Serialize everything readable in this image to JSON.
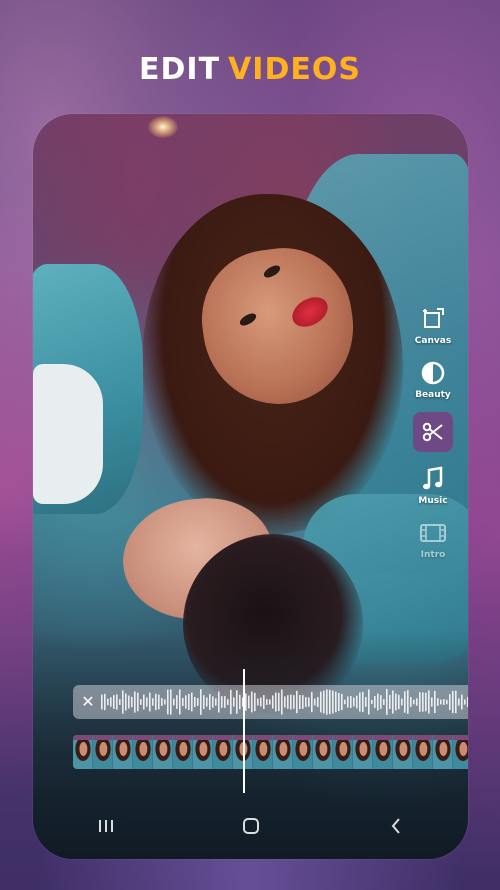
{
  "headline": {
    "word1": "EDIT",
    "word2": "VIDEOS"
  },
  "colors": {
    "accent": "#ffb21e",
    "tool_active_bg": "#6d4a86",
    "background": "#5b3f78"
  },
  "tools": [
    {
      "label": "Canvas",
      "icon": "canvas-icon"
    },
    {
      "label": "Beauty",
      "icon": "beauty-icon"
    },
    {
      "label": "",
      "icon": "scissors-icon",
      "active": true
    },
    {
      "label": "Music",
      "icon": "music-note-icon"
    },
    {
      "label": "Intro",
      "icon": "film-strip-icon"
    }
  ],
  "timeline": {
    "audio_track": {
      "remove_icon": "close-icon"
    },
    "video_track": {
      "thumbnail_count": 20
    }
  },
  "navbar": [
    {
      "icon": "recents-icon"
    },
    {
      "icon": "home-icon"
    },
    {
      "icon": "back-icon"
    }
  ]
}
